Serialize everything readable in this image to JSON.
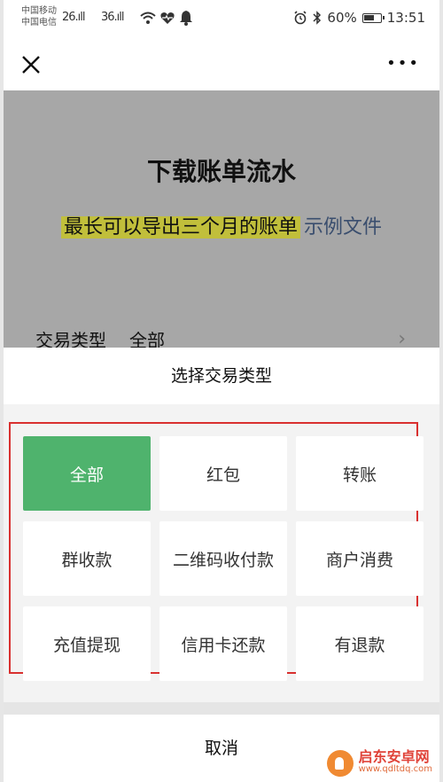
{
  "status_bar": {
    "carrier_1": "中国移动",
    "carrier_2": "中国电信",
    "signal_1": "26.ıll",
    "signal_2": "36.ıll",
    "battery_percent": "60%",
    "time": "13:51"
  },
  "nav": {
    "close_icon": "close-icon",
    "more_icon": "more-dots-icon"
  },
  "page": {
    "title": "下载账单流水",
    "subtitle_highlight": "最长可以导出三个月的账单",
    "sample_link": "示例文件",
    "trade_type_label": "交易类型",
    "trade_type_value": "全部"
  },
  "sheet": {
    "title": "选择交易类型",
    "options": [
      {
        "label": "全部",
        "selected": true
      },
      {
        "label": "红包",
        "selected": false
      },
      {
        "label": "转账",
        "selected": false
      },
      {
        "label": "群收款",
        "selected": false
      },
      {
        "label": "二维码收付款",
        "selected": false
      },
      {
        "label": "商户消费",
        "selected": false
      },
      {
        "label": "充值提现",
        "selected": false
      },
      {
        "label": "信用卡还款",
        "selected": false
      },
      {
        "label": "有退款",
        "selected": false
      }
    ],
    "cancel_label": "取消",
    "highlight_color": "#d9302f",
    "selected_color": "#4fb36d"
  },
  "watermark": {
    "main": "启东安卓网",
    "url": "www.qdltdq.com"
  }
}
